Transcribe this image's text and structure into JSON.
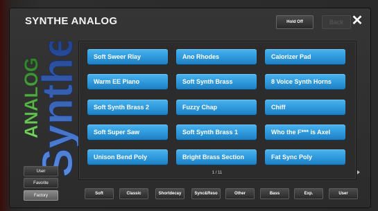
{
  "header": {
    "title": "SYNTHE ANALOG",
    "hold_label": "Hold Off",
    "back_label": "Back",
    "close_label": "✕"
  },
  "logo": {
    "line1": "ANALOG",
    "line2": "Synthe"
  },
  "presets": [
    "Soft Sweer Rlay",
    "Ano Rhodes",
    "Calorizer Pad",
    "Warm EE Piano",
    "Soft Synth Brass",
    "8 Voice Synth Horns",
    "Soft Synth Brass 2",
    "Fuzzy Chap",
    "Chiff",
    "Soft Super Saw",
    "Soft Synth Brass 1",
    "Who the F*** is Axel",
    "Unison Bend Poly",
    "Bright Brass Section",
    "Fat Sync Poly"
  ],
  "pagination": {
    "label": "1 / 11"
  },
  "side_buttons": [
    {
      "label": "User",
      "active": false
    },
    {
      "label": "Favorite",
      "active": false
    },
    {
      "label": "Factory",
      "active": true
    }
  ],
  "categories": [
    "Soft",
    "Classic",
    "Shortdecay",
    "Sync&Reso",
    "Other",
    "Bass",
    "Exp.",
    "User"
  ],
  "colors": {
    "preset_button": "#2f98db",
    "logo_green": "#4fae3b",
    "logo_blue": "#3a6fd0"
  }
}
